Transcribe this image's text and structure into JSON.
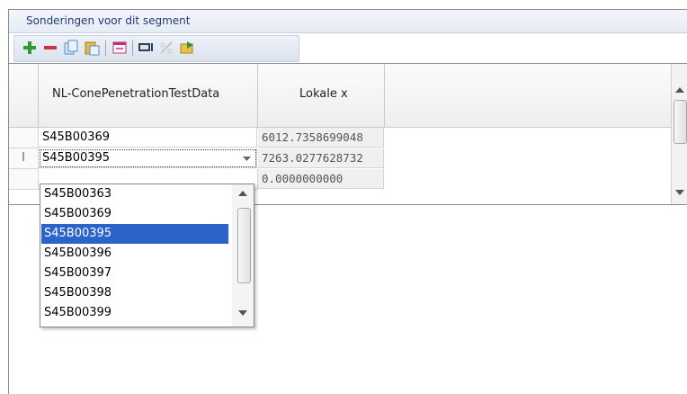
{
  "panel": {
    "title": "Sonderingen voor dit segment"
  },
  "toolbar": {
    "buttons": [
      {
        "name": "add-icon"
      },
      {
        "name": "remove-icon"
      },
      {
        "name": "copy-icon"
      },
      {
        "name": "paste-icon"
      },
      {
        "name": "range-icon"
      },
      {
        "name": "monitor-icon"
      },
      {
        "name": "clear-icon"
      },
      {
        "name": "import-icon"
      }
    ]
  },
  "grid": {
    "columns": [
      "NL-ConePenetrationTestData",
      "Lokale x"
    ],
    "rows": [
      {
        "name": "S45B00369",
        "x": "6012.7358699048"
      },
      {
        "name": "S45B00395",
        "x": "7263.0277628732"
      },
      {
        "name": "",
        "x": "0.0000000000"
      }
    ],
    "editing_marker": "I"
  },
  "dropdown": {
    "options": [
      "S45B00363",
      "S45B00369",
      "S45B00395",
      "S45B00396",
      "S45B00397",
      "S45B00398",
      "S45B00399"
    ],
    "selected": "S45B00395"
  },
  "colors": {
    "accent": "#2b63c8",
    "title_text": "#1f3b7a"
  }
}
